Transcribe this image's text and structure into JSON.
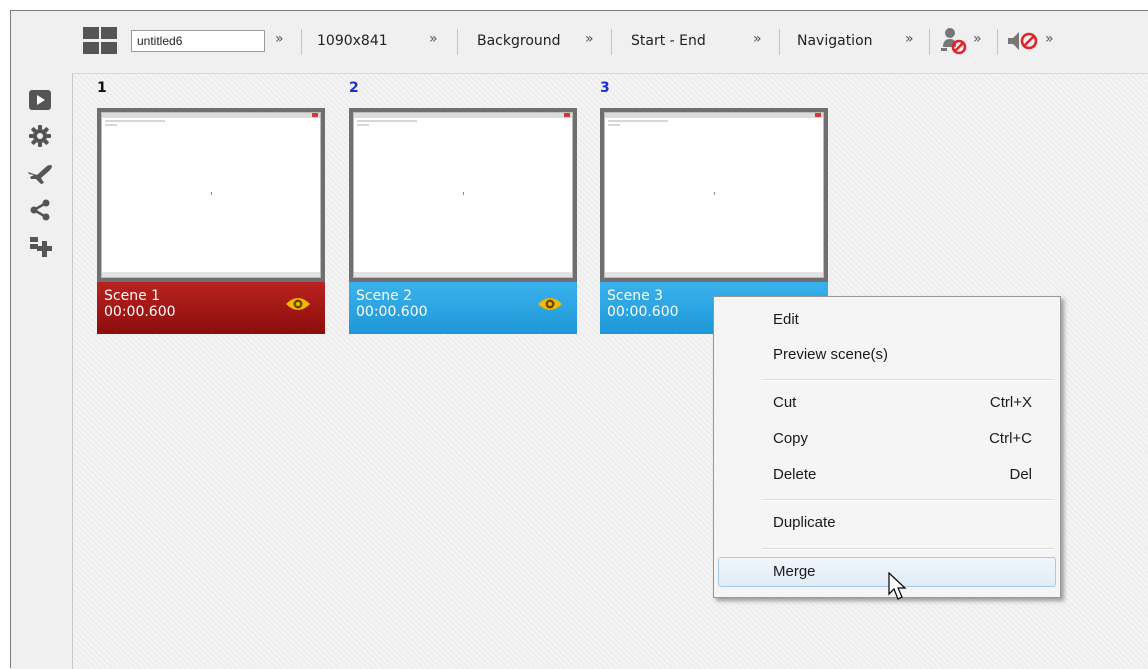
{
  "toolbar": {
    "project_name": "untitled6",
    "resolution": "1090x841",
    "background_label": "Background",
    "range_label": "Start - End",
    "navigation_label": "Navigation",
    "chevron": "»"
  },
  "scenes": [
    {
      "number": "1",
      "name": "Scene 1",
      "duration": "00:00.600",
      "color": "#a5181a"
    },
    {
      "number": "2",
      "name": "Scene 2",
      "duration": "00:00.600",
      "color": "#2aa6e4"
    },
    {
      "number": "3",
      "name": "Scene 3",
      "duration": "00:00.600",
      "color": "#2aa6e4"
    }
  ],
  "context_menu": {
    "edit": "Edit",
    "preview": "Preview scene(s)",
    "cut": "Cut",
    "cut_shortcut": "Ctrl+X",
    "copy": "Copy",
    "copy_shortcut": "Ctrl+C",
    "delete": "Delete",
    "delete_shortcut": "Del",
    "duplicate": "Duplicate",
    "merge": "Merge"
  },
  "colors": {
    "accent_blue": "#2aa6e4",
    "selected_red": "#a5181a",
    "eye_yellow": "#f4b800",
    "scene_number_blue": "#1a2fd0"
  }
}
